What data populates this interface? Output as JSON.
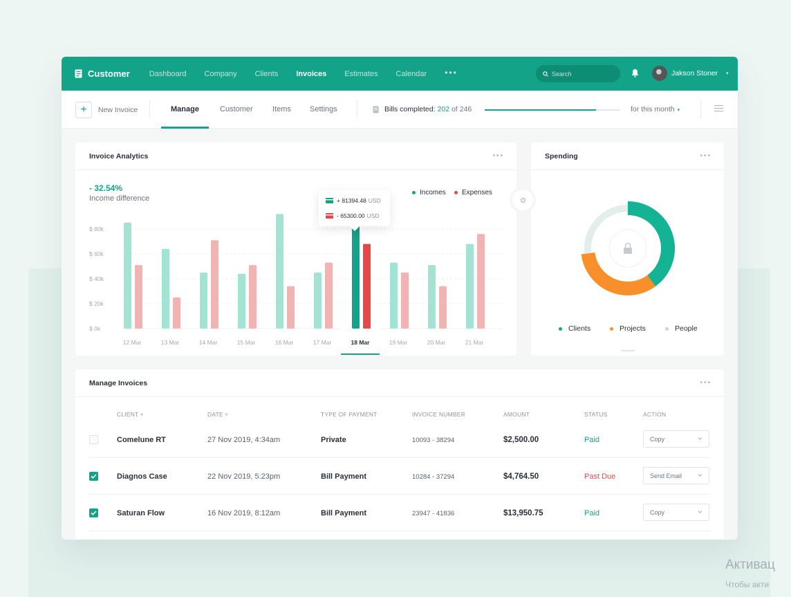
{
  "topnav": {
    "brand": "Customer",
    "items": [
      {
        "label": "Dashboard",
        "active": false
      },
      {
        "label": "Company",
        "active": false
      },
      {
        "label": "Clients",
        "active": false
      },
      {
        "label": "Invoices",
        "active": true
      },
      {
        "label": "Estimates",
        "active": false
      },
      {
        "label": "Calendar",
        "active": false
      }
    ],
    "more": "•••",
    "search_placeholder": "Search",
    "user_name": "Jakson Stoner",
    "caret": "▾"
  },
  "toolbar": {
    "new_invoice": "New Invoice",
    "tabs": [
      {
        "label": "Manage",
        "active": true
      },
      {
        "label": "Customer",
        "active": false
      },
      {
        "label": "Items",
        "active": false
      },
      {
        "label": "Settings",
        "active": false
      }
    ],
    "bills_label": "Bills completed:",
    "bills_done": "202",
    "bills_of": "of 246",
    "bills_progress": 0.82,
    "period": "for this month",
    "period_caret": "▾"
  },
  "analytics": {
    "title": "Invoice Analytics",
    "change": "- 32.54%",
    "change_label": "Income difference",
    "legend_incomes": "Incomes",
    "legend_expenses": "Expenses",
    "tooltip_income": "+ 81394.48",
    "tooltip_expense": "- 65300.00",
    "tooltip_unit": "USD"
  },
  "chart_data": {
    "type": "bar",
    "categories": [
      "12 Mar",
      "13 Mar",
      "14 Mar",
      "15 Mar",
      "16 Mar",
      "17 Mar",
      "18 Mar",
      "19 Mar",
      "20 Mar",
      "21 Mar"
    ],
    "series": [
      {
        "name": "Incomes",
        "values": [
          85000,
          64000,
          45000,
          44000,
          92000,
          45000,
          83000,
          53000,
          51000,
          68000
        ]
      },
      {
        "name": "Expenses",
        "values": [
          51000,
          25000,
          71000,
          51000,
          34000,
          53000,
          68000,
          45000,
          34000,
          76000
        ]
      }
    ],
    "y_ticks": [
      "$ 80k",
      "$ 60k",
      "$ 40k",
      "$ 20k",
      "$ 0k"
    ],
    "ylim": [
      0,
      100000
    ],
    "highlight": "18 Mar",
    "colors": {
      "income": "#a3e3d4",
      "expense": "#f2b3b3",
      "income_active": "#13a388",
      "expense_active": "#e8474a"
    }
  },
  "spending": {
    "title": "Spending",
    "legend": [
      {
        "label": "Clients",
        "color": "#13a388"
      },
      {
        "label": "Projects",
        "color": "#f98f2a"
      },
      {
        "label": "People",
        "color": "#c7d6d1"
      }
    ],
    "donut": [
      {
        "name": "Clients",
        "value": 0.4,
        "color": "#13b394"
      },
      {
        "name": "Projects",
        "value": 0.33,
        "color": "#f98f2a"
      },
      {
        "name": "People",
        "value": 0.27,
        "color": "#e3eeea"
      }
    ]
  },
  "manage": {
    "title": "Manage Invoices",
    "columns": [
      "CLIENT",
      "DATE",
      "TYPE OF PAYMENT",
      "INVOICE NUMBER",
      "AMOUNT",
      "STATUS",
      "ACTION"
    ],
    "sort_mark": "▾",
    "rows": [
      {
        "checked": false,
        "client": "Comelune RT",
        "date": "27 Nov 2019, 4:34am",
        "type": "Private",
        "number": "10093 - 38294",
        "amount": "$2,500.00",
        "status": "Paid",
        "status_color": "#13a388",
        "action": "Copy"
      },
      {
        "checked": true,
        "client": "Diagnos Case",
        "date": "22 Nov 2019, 5:23pm",
        "type": "Bill Payment",
        "number": "10284 - 37294",
        "amount": "$4,764.50",
        "status": "Past Due",
        "status_color": "#e8474a",
        "action": "Send Email"
      },
      {
        "checked": true,
        "client": "Saturan Flow",
        "date": "16 Nov 2019, 8:12am",
        "type": "Bill Payment",
        "number": "23947 - 41836",
        "amount": "$13,950.75",
        "status": "Paid",
        "status_color": "#13a388",
        "action": "Copy"
      }
    ]
  },
  "watermark": {
    "line1": "Активац",
    "line2": "Чтобы акти"
  },
  "colors": {
    "accent": "#13a388",
    "danger": "#e8474a",
    "orange": "#f98f2a"
  }
}
